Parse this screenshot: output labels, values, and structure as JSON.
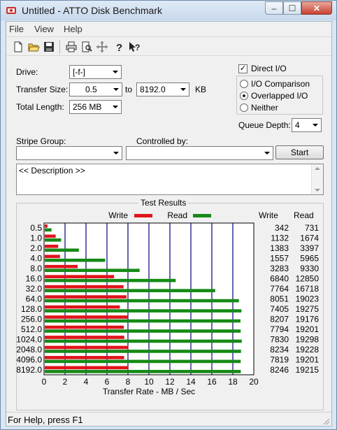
{
  "window": {
    "title": "Untitled - ATTO Disk Benchmark",
    "min": "–",
    "max": "☐",
    "close": "✕"
  },
  "menu": {
    "file": "File",
    "view": "View",
    "help": "Help"
  },
  "toolbar": {
    "icons": [
      "new-document-icon",
      "open-folder-icon",
      "save-disk-icon",
      "print-icon",
      "print-preview-icon",
      "move-cross-icon",
      "help-question-icon",
      "context-help-icon"
    ]
  },
  "form": {
    "drive_label": "Drive:",
    "drive_value": "[-f-]",
    "transfer_label": "Transfer Size:",
    "transfer_from": "0.5",
    "to_label": "to",
    "transfer_to": "8192.0",
    "kb_label": "KB",
    "total_label": "Total Length:",
    "total_value": "256 MB",
    "direct_io": "Direct I/O",
    "io_comparison": "I/O Comparison",
    "overlapped_io": "Overlapped I/O",
    "neither": "Neither",
    "queue_label": "Queue Depth:",
    "queue_value": "4",
    "stripe_label": "Stripe Group:",
    "controlled_label": "Controlled by:",
    "start": "Start",
    "description": "<< Description >>"
  },
  "results": {
    "title": "Test Results",
    "write_col": "Write",
    "read_col": "Read"
  },
  "colors": {
    "write": "#e0141b",
    "read": "#168a16",
    "grid": "#000080"
  },
  "chart_data": {
    "type": "bar",
    "orientation": "horizontal",
    "categories": [
      "0.5",
      "1.0",
      "2.0",
      "4.0",
      "8.0",
      "16.0",
      "32.0",
      "64.0",
      "128.0",
      "256.0",
      "512.0",
      "1024.0",
      "2048.0",
      "4096.0",
      "8192.0"
    ],
    "series": [
      {
        "name": "Write",
        "values": [
          0.33,
          1.11,
          1.35,
          1.52,
          3.21,
          6.68,
          7.58,
          7.86,
          7.23,
          8.01,
          7.61,
          7.65,
          8.04,
          7.64,
          8.05
        ]
      },
      {
        "name": "Read",
        "values": [
          0.71,
          1.63,
          3.32,
          5.83,
          9.11,
          12.55,
          16.32,
          18.58,
          18.82,
          18.73,
          18.75,
          18.85,
          18.78,
          18.75,
          18.76
        ]
      }
    ],
    "write_values": [
      "342",
      "1132",
      "1383",
      "1557",
      "3283",
      "6840",
      "7764",
      "8051",
      "7405",
      "8207",
      "7794",
      "7830",
      "8234",
      "7819",
      "8246"
    ],
    "read_values": [
      "731",
      "1674",
      "3397",
      "5965",
      "9330",
      "12850",
      "16718",
      "19023",
      "19275",
      "19176",
      "19201",
      "19298",
      "19228",
      "19201",
      "19215"
    ],
    "xlabel": "Transfer Rate - MB / Sec",
    "xticks": [
      "0",
      "2",
      "4",
      "6",
      "8",
      "10",
      "12",
      "14",
      "16",
      "18",
      "20"
    ],
    "xlim": [
      0,
      20
    ],
    "legend": "top",
    "grid": true
  },
  "status": {
    "text": "For Help, press F1"
  }
}
